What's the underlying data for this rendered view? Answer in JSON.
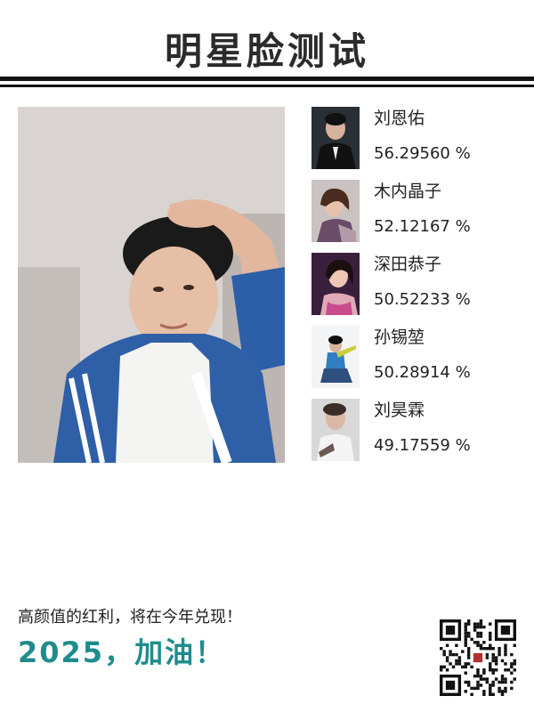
{
  "header": {
    "title": "明星脸测试"
  },
  "matches": [
    {
      "name": "刘恩佑",
      "score": "56.29560 %"
    },
    {
      "name": "木内晶子",
      "score": "52.12167 %"
    },
    {
      "name": "深田恭子",
      "score": "50.52233 %"
    },
    {
      "name": "孙锡堃",
      "score": "50.28914 %"
    },
    {
      "name": "刘昊霖",
      "score": "49.17559 %"
    }
  ],
  "footer": {
    "tagline": "高颜值的红利，将在今年兑现！",
    "slogan": "2025，加油！"
  },
  "colors": {
    "accent": "#1f8c8c",
    "rule": "#111111"
  }
}
